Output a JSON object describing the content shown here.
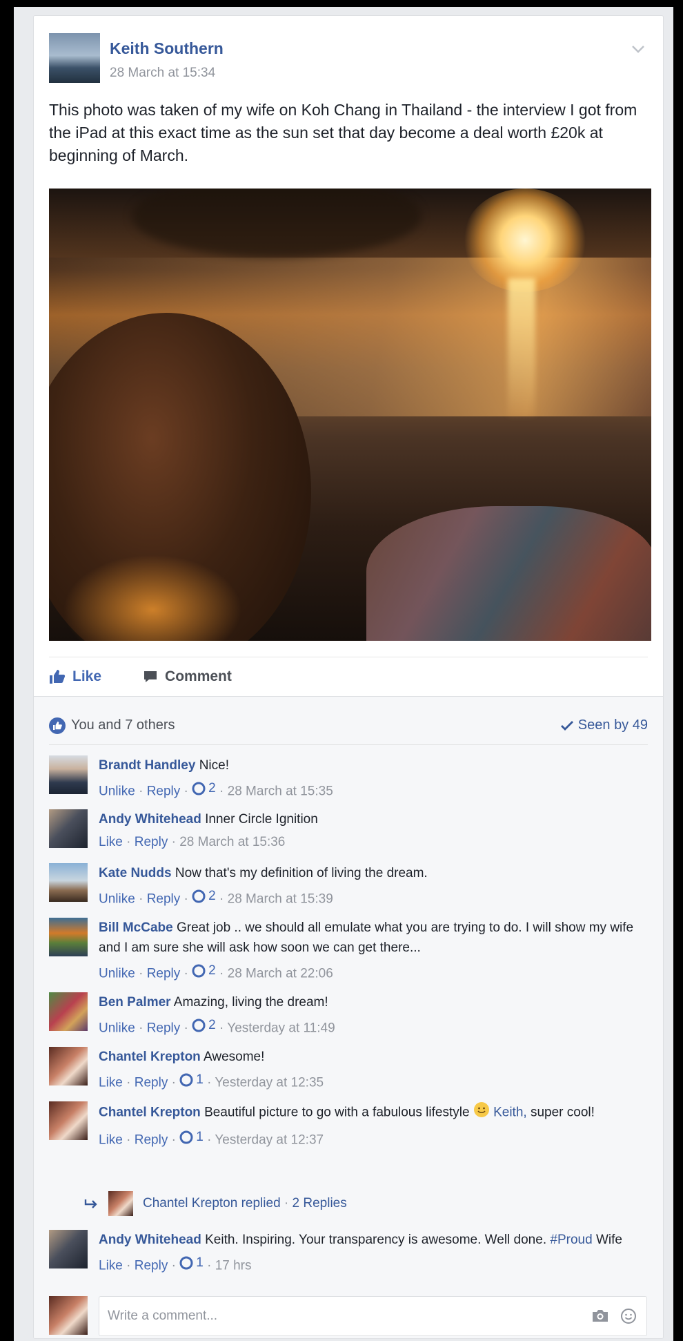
{
  "post": {
    "author": "Keith Southern",
    "timestamp": "28 March at 15:34",
    "text": "This photo was taken of my wife on Koh Chang in Thailand - the interview I got from the iPad at this exact time as the sun set that day become a deal worth £20k at beginning of March.",
    "actions": {
      "like": "Like",
      "comment": "Comment"
    }
  },
  "summary": {
    "reactions": "You and 7 others",
    "seen": "Seen by 49"
  },
  "comments": [
    {
      "name": "Brandt Handley",
      "text": "Nice!",
      "like": "Unlike",
      "reply": "Reply",
      "count": "2",
      "time": "28 March at 15:35"
    },
    {
      "name": "Andy Whitehead",
      "text": "Inner Circle Ignition",
      "like": "Like",
      "reply": "Reply",
      "time": "28 March at 15:36"
    },
    {
      "name": "Kate Nudds",
      "text": "Now that's my definition of living the dream.",
      "like": "Unlike",
      "reply": "Reply",
      "count": "2",
      "time": "28 March at 15:39"
    },
    {
      "name": "Bill McCabe",
      "text": "Great job .. we should all emulate what you are trying to do. I will show my wife and I am sure she will ask how soon we can get there...",
      "like": "Unlike",
      "reply": "Reply",
      "count": "2",
      "time": "28 March at 22:06"
    },
    {
      "name": "Ben Palmer",
      "text": "Amazing, living the dream!",
      "like": "Unlike",
      "reply": "Reply",
      "count": "2",
      "time": "Yesterday at 11:49"
    },
    {
      "name": "Chantel Krepton",
      "text": "Awesome!",
      "like": "Like",
      "reply": "Reply",
      "count": "1",
      "time": "Yesterday at 12:35"
    },
    {
      "name": "Chantel Krepton",
      "text": "Beautiful picture to go with a fabulous lifestyle",
      "mention": "Keith,",
      "text2": "super cool!",
      "like": "Like",
      "reply": "Reply",
      "count": "1",
      "time": "Yesterday at 12:37"
    },
    {
      "name": "Andy Whitehead",
      "text": "Keith. Inspiring. Your transparency is awesome. Well done.",
      "mention": "#Proud",
      "text2": "Wife",
      "like": "Like",
      "reply": "Reply",
      "count": "1",
      "time": "17 hrs"
    }
  ],
  "replies_summary": {
    "name": "Chantel Krepton replied",
    "count": "2 Replies"
  },
  "write_comment": {
    "placeholder": "Write a comment..."
  },
  "colors": {
    "link": "#365899",
    "accent": "#4267b2",
    "meta": "#90949c"
  }
}
